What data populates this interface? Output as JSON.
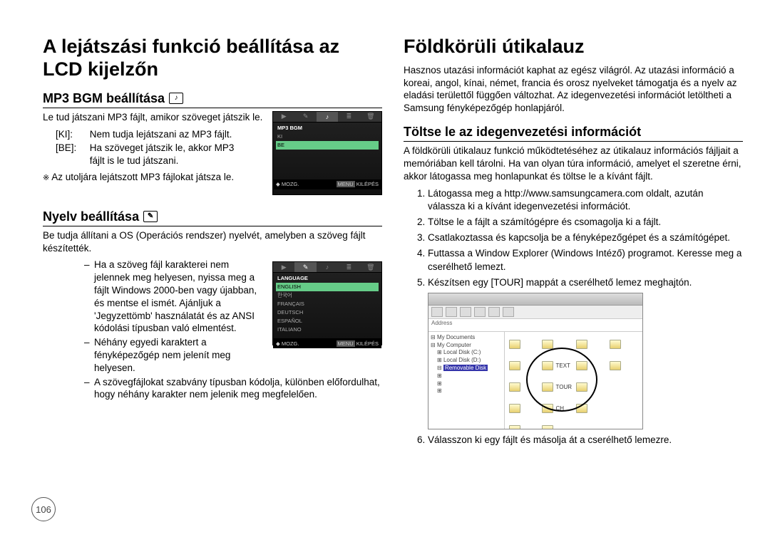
{
  "page_number": "106",
  "left": {
    "h1": "A lejátszási funkció beállítása az LCD kijelzőn",
    "sec1": {
      "h2": "MP3 BGM beállítása",
      "icon": "♪",
      "intro": "Le tud játszani MP3 fájlt, amikor szöveget játszik le.",
      "rows": [
        {
          "k": "[KI]:",
          "v": "Nem tudja lejátszani az MP3 fájlt."
        },
        {
          "k": "[BE]:",
          "v": "Ha szöveget játszik le, akkor MP3 fájlt is le tud játszani."
        }
      ],
      "note": "Az utoljára lejátszott MP3 fájlokat játsza le.",
      "device": {
        "tabs_active": 2,
        "title": "MP3 BGM",
        "items": [
          "KI",
          "BE"
        ],
        "footer_move": "MOZG.",
        "footer_menu": "MENU",
        "footer_exit": "KILÉPÉS"
      }
    },
    "sec2": {
      "h2": "Nyelv beállítása",
      "icon": "✎",
      "intro": "Be tudja állítani a OS (Operációs rendszer) nyelvét, amelyben a szöveg fájlt készítették.",
      "bullets": [
        "Ha a szöveg fájl karakterei nem jelennek meg helyesen, nyissa meg a fájlt Windows 2000-ben vagy újabban, és mentse el ismét. Ajánljuk a 'Jegyzettömb' használatát és az ANSI kódolási típusban való elmentést.",
        "Néhány egyedi karaktert a fényképezőgép nem jelenít meg helyesen.",
        "A szövegfájlokat szabvány típusban kódolja, különben előfordulhat, hogy néhány karakter nem jelenik meg megfelelően."
      ],
      "device": {
        "title": "LANGUAGE",
        "items": [
          "ENGLISH",
          "한국어",
          "FRANÇAIS",
          "DEUTSCH",
          "ESPAÑOL",
          "ITALIANO"
        ],
        "footer_move": "MOZG.",
        "footer_menu": "MENU",
        "footer_exit": "KILÉPÉS"
      }
    }
  },
  "right": {
    "h1": "Földkörüli útikalauz",
    "intro": "Hasznos utazási információt kaphat az egész világról. Az utazási információ a koreai, angol, kínai, német, francia és orosz nyelveket támogatja és a nyelv az eladási területtől függően változhat. Az idegenvezetési információt letöltheti a Samsung fényképezőgép honlapjáról.",
    "sec1": {
      "h2": "Töltse le az idegenvezetési információt",
      "intro": "A földkörüli útikalauz funkció működtetéséhez az útikalauz információs fájljait a memóriában kell tárolni. Ha van olyan túra információ, amelyet el szeretne érni, akkor látogassa meg honlapunkat és töltse le a kívánt fájlt.",
      "steps": [
        "Látogassa meg a http://www.samsungcamera.com oldalt, azután válassza ki a kívánt idegenvezetési információt.",
        "Töltse le a fájlt a számítógépre és csomagolja ki a fájlt.",
        "Csatlakoztassa és kapcsolja be a fényképezőgépet és a számítógépet.",
        "Futtassa a Window Explorer (Windows Intéző) programot. Keresse meg a cserélhető lemezt.",
        "Készítsen egy  [TOUR] mappát a cserélhető lemez meghajtón."
      ],
      "step6": "Válasszon ki egy fájlt és másolja át a cserélhető lemezre.",
      "explorer": {
        "addr": "Address",
        "tree": [
          "My Documents",
          "My Computer",
          "Local Disk (C:)",
          "Local Disk (D:)",
          "Removable Disk"
        ],
        "visible_folders": [
          "TEXT",
          "TOUR",
          "CH"
        ]
      }
    }
  }
}
